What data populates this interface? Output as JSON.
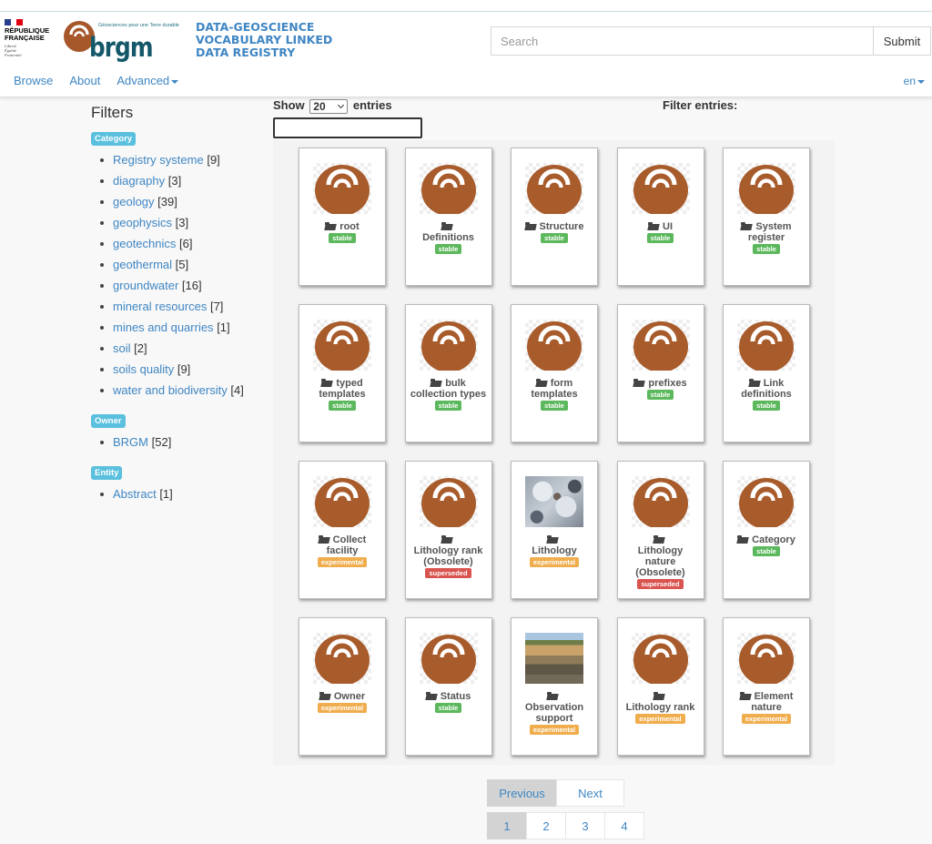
{
  "header": {
    "republique": {
      "line1": "RÉPUBLIQUE",
      "line2": "FRANÇAISE",
      "motto": [
        "Liberté",
        "Égalité",
        "Fraternité"
      ]
    },
    "brgm": {
      "word": "brgm",
      "tagline": "Géosciences pour une Terre durable"
    },
    "site_title": "DATA-GEOSCIENCE VOCABULARY LINKED DATA REGISTRY",
    "search": {
      "placeholder": "Search",
      "value": "",
      "submit_label": "Submit"
    },
    "nav": [
      {
        "label": "Browse",
        "icon": null
      },
      {
        "label": "About",
        "icon": null
      },
      {
        "label": "Advanced",
        "icon": "caret-down-icon"
      }
    ],
    "language": "en",
    "colors": {
      "brand_blue": "#3f86c3",
      "brgm_brown": "#a6582a",
      "brgm_teal": "#135768"
    }
  },
  "sidebar": {
    "title": "Filters",
    "groups": [
      {
        "label": "Category",
        "items": [
          {
            "label": "Registry systeme",
            "count": "[9]"
          },
          {
            "label": "diagraphy",
            "count": "[3]"
          },
          {
            "label": "geology",
            "count": "[39]"
          },
          {
            "label": "geophysics",
            "count": "[3]"
          },
          {
            "label": "geotechnics",
            "count": "[6]"
          },
          {
            "label": "geothermal",
            "count": "[5]"
          },
          {
            "label": "groundwater",
            "count": "[16]"
          },
          {
            "label": "mineral resources",
            "count": "[7]"
          },
          {
            "label": "mines and quarries",
            "count": "[1]"
          },
          {
            "label": "soil",
            "count": "[2]"
          },
          {
            "label": "soils quality",
            "count": "[9]"
          },
          {
            "label": "water and biodiversity",
            "count": "[4]"
          }
        ]
      },
      {
        "label": "Owner",
        "items": [
          {
            "label": "BRGM",
            "count": "[52]"
          }
        ]
      },
      {
        "label": "Entity",
        "items": [
          {
            "label": "Abstract",
            "count": "[1]"
          }
        ]
      }
    ],
    "badge_color": "#5bc0de"
  },
  "table_controls": {
    "show_label": "Show",
    "show_value": "20",
    "entries_label": "entries",
    "filter_label": "Filter entries:",
    "filter_value": ""
  },
  "cards": [
    {
      "title": "root",
      "status": "stable",
      "thumb": "brgm-logo",
      "title_break": false
    },
    {
      "title": "Definitions",
      "status": "stable",
      "thumb": "brgm-logo",
      "title_break": true
    },
    {
      "title": "Structure",
      "status": "stable",
      "thumb": "brgm-logo",
      "title_break": false
    },
    {
      "title": "UI",
      "status": "stable",
      "thumb": "brgm-logo",
      "title_break": false
    },
    {
      "title": "System register",
      "status": "stable",
      "thumb": "brgm-logo",
      "title_break": false
    },
    {
      "title": "typed templates",
      "status": "stable",
      "thumb": "brgm-logo",
      "title_break": false
    },
    {
      "title": "bulk collection types",
      "status": "stable",
      "thumb": "brgm-logo",
      "title_break": false
    },
    {
      "title": "form templates",
      "status": "stable",
      "thumb": "brgm-logo",
      "title_break": false
    },
    {
      "title": "prefixes",
      "status": "stable",
      "thumb": "brgm-logo",
      "title_break": false
    },
    {
      "title": "Link definitions",
      "status": "stable",
      "thumb": "brgm-logo",
      "title_break": false
    },
    {
      "title": "Collect facility",
      "status": "experimental",
      "thumb": "brgm-logo",
      "title_break": false
    },
    {
      "title": "Lithology rank (Obsolete)",
      "status": "superseded",
      "thumb": "brgm-logo",
      "title_break": true
    },
    {
      "title": "Lithology",
      "status": "experimental",
      "thumb": "granite-photo",
      "title_break": true
    },
    {
      "title": "Lithology nature (Obsolete)",
      "status": "superseded",
      "thumb": "brgm-logo",
      "title_break": true
    },
    {
      "title": "Category",
      "status": "stable",
      "thumb": "brgm-logo",
      "title_break": false
    },
    {
      "title": "Owner",
      "status": "experimental",
      "thumb": "brgm-logo",
      "title_break": false
    },
    {
      "title": "Status",
      "status": "stable",
      "thumb": "brgm-logo",
      "title_break": false
    },
    {
      "title": "Observation support",
      "status": "experimental",
      "thumb": "quarry-photo",
      "title_break": true
    },
    {
      "title": "Lithology rank",
      "status": "experimental",
      "thumb": "brgm-logo",
      "title_break": true
    },
    {
      "title": "Element nature",
      "status": "experimental",
      "thumb": "brgm-logo",
      "title_break": false
    }
  ],
  "status_colors": {
    "stable": "#5cb85c",
    "experimental": "#f0ad4e",
    "superseded": "#d9534f"
  },
  "pagination": {
    "previous_label": "Previous",
    "next_label": "Next",
    "pages": [
      "1",
      "2",
      "3",
      "4"
    ],
    "current_page": "1"
  }
}
